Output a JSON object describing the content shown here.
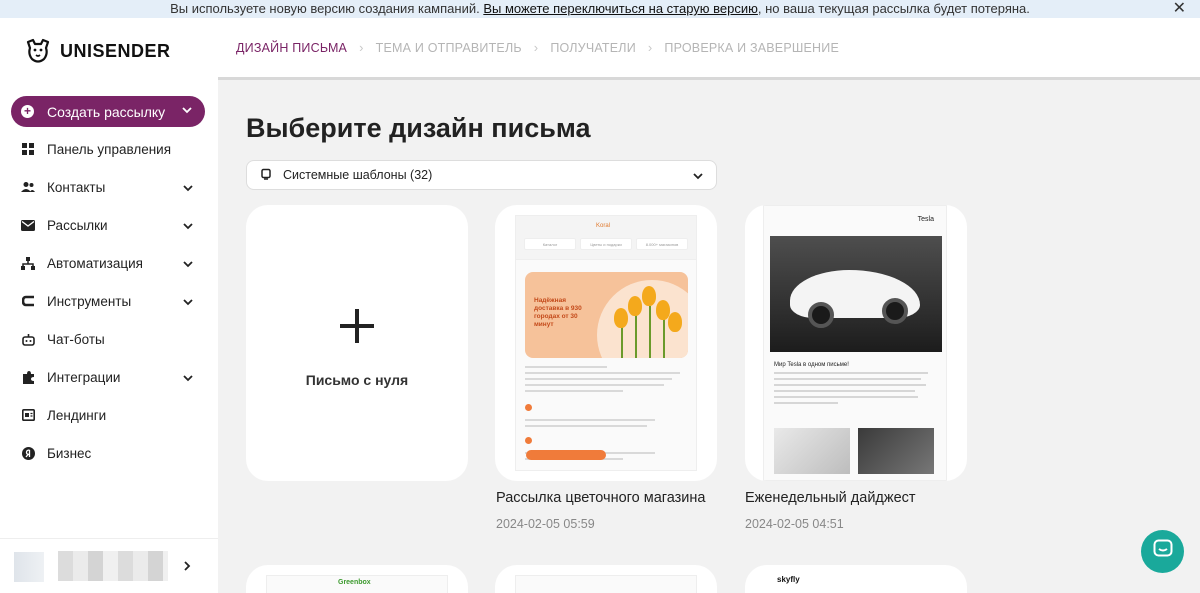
{
  "banner": {
    "text_before": "Вы используете новую версию создания кампаний.",
    "link": "Вы можете переключиться на старую версию",
    "text_after": ", но ваша текущая рассылка будет потеряна.",
    "close": "✕"
  },
  "logo": {
    "text": "UNISENDER",
    "icon": "dog-logo-icon"
  },
  "sidebar": {
    "create_button": {
      "label": "Создать рассылку",
      "icon": "plus-circle-icon"
    },
    "items": [
      {
        "label": "Панель управления",
        "icon": "dashboard-icon",
        "expandable": false
      },
      {
        "label": "Контакты",
        "icon": "contacts-icon",
        "expandable": true
      },
      {
        "label": "Рассылки",
        "icon": "mail-icon",
        "expandable": true
      },
      {
        "label": "Автоматизация",
        "icon": "automation-icon",
        "expandable": true
      },
      {
        "label": "Инструменты",
        "icon": "tools-icon",
        "expandable": true
      },
      {
        "label": "Чат-боты",
        "icon": "bot-icon",
        "expandable": false
      },
      {
        "label": "Интеграции",
        "icon": "puzzle-icon",
        "expandable": true
      },
      {
        "label": "Лендинги",
        "icon": "landing-icon",
        "expandable": false
      },
      {
        "label": "Бизнес",
        "icon": "yandex-icon",
        "expandable": false
      }
    ]
  },
  "steps": [
    {
      "label": "ДИЗАЙН ПИСЬМА",
      "active": true
    },
    {
      "label": "ТЕМА И ОТПРАВИТЕЛЬ",
      "active": false
    },
    {
      "label": "ПОЛУЧАТЕЛИ",
      "active": false
    },
    {
      "label": "ПРОВЕРКА И ЗАВЕРШЕНИЕ",
      "active": false
    }
  ],
  "main": {
    "title": "Выберите дизайн письма",
    "template_select": "Системные шаблоны (32)",
    "blank_card": {
      "label": "Письмо с нуля"
    },
    "templates": [
      {
        "name": "Рассылка цветочного магазина",
        "date": "2024-02-05 05:59"
      },
      {
        "name": "Еженедельный дайджест",
        "date": "2024-02-05 04:51"
      }
    ]
  },
  "previews": {
    "flower": {
      "logo": "Koral",
      "tabs": [
        "Каталог",
        "Цветы и подарки",
        "8.000+ магазинов"
      ],
      "hero": "Надёжная доставка в 930 городах от 30 минут"
    },
    "tesla": {
      "logo": "Tesla",
      "heading": "Мир Tesla в одном письме!"
    },
    "row2": [
      "Greenbox",
      "skyfly"
    ]
  },
  "colors": {
    "accent": "#7a2466",
    "chat": "#1aa99b",
    "banner": "#e4eef8"
  }
}
